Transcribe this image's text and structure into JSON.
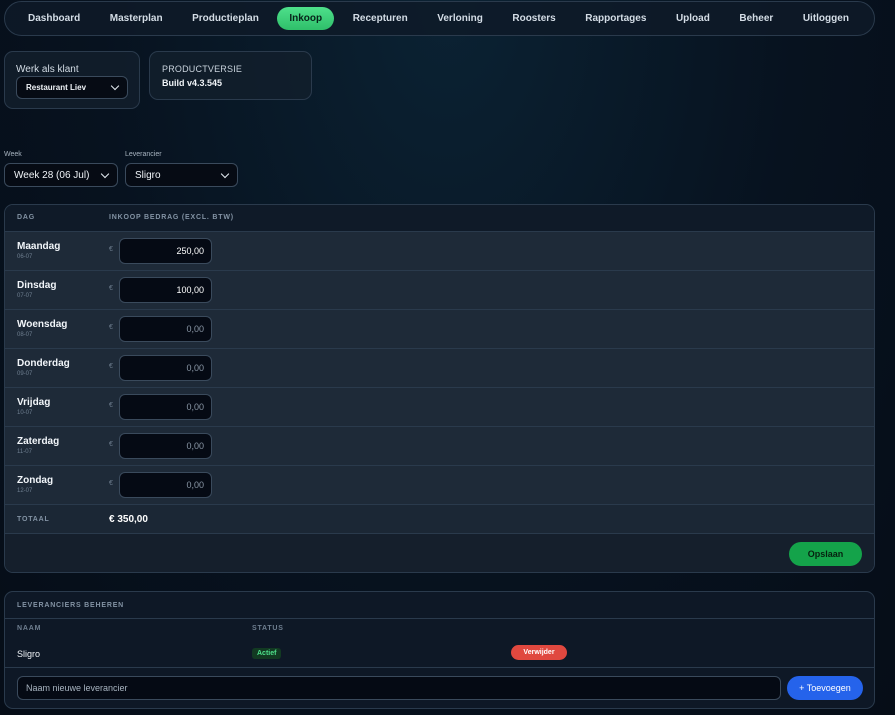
{
  "nav": {
    "items": [
      {
        "label": "Dashboard",
        "name": "nav-dashboard"
      },
      {
        "label": "Masterplan",
        "name": "nav-masterplan"
      },
      {
        "label": "Productieplan",
        "name": "nav-productieplan"
      },
      {
        "label": "Inkoop",
        "name": "nav-inkoop",
        "active": true
      },
      {
        "label": "Recepturen",
        "name": "nav-recepturen"
      },
      {
        "label": "Verloning",
        "name": "nav-verloning"
      },
      {
        "label": "Roosters",
        "name": "nav-roosters"
      },
      {
        "label": "Rapportages",
        "name": "nav-rapportages"
      },
      {
        "label": "Upload",
        "name": "nav-upload"
      },
      {
        "label": "Beheer",
        "name": "nav-beheer"
      },
      {
        "label": "Uitloggen",
        "name": "nav-uitloggen"
      }
    ],
    "active_color": "#3fd37c"
  },
  "klant": {
    "label": "Werk als klant",
    "selected": "Restaurant Liev"
  },
  "versie": {
    "label": "PRODUCTVERSIE",
    "value": "Build v4.3.545"
  },
  "filters": {
    "week_label": "Week",
    "week_selected": "Week 28 (06 Jul)",
    "leverancier_label": "Leverancier",
    "leverancier_selected": "Sligro"
  },
  "inkoop": {
    "col_dag": "DAG",
    "col_bedrag": "INKOOP BEDRAG (EXCL. BTW)",
    "currency": "€",
    "days": [
      {
        "name": "Maandag",
        "date": "06-07",
        "amount": "250,00"
      },
      {
        "name": "Dinsdag",
        "date": "07-07",
        "amount": "100,00"
      },
      {
        "name": "Woensdag",
        "date": "08-07",
        "amount": "0,00"
      },
      {
        "name": "Donderdag",
        "date": "09-07",
        "amount": "0,00"
      },
      {
        "name": "Vrijdag",
        "date": "10-07",
        "amount": "0,00"
      },
      {
        "name": "Zaterdag",
        "date": "11-07",
        "amount": "0,00"
      },
      {
        "name": "Zondag",
        "date": "12-07",
        "amount": "0,00"
      }
    ],
    "total_label": "TOTAAL",
    "total_value": "€ 350,00",
    "save_label": "Opslaan"
  },
  "leveranciers": {
    "title": "LEVERANCIERS BEHEREN",
    "col_naam": "NAAM",
    "col_status": "STATUS",
    "rows": [
      {
        "name": "Sligro",
        "status": "Actief",
        "delete_label": "Verwijder"
      }
    ],
    "new_placeholder": "Naam nieuwe leverancier",
    "add_label": "+ Toevoegen"
  },
  "colors": {
    "save": "#14a34a",
    "delete": "#e0483f",
    "add": "#2563eb",
    "active_badge": "#4ee08b"
  }
}
